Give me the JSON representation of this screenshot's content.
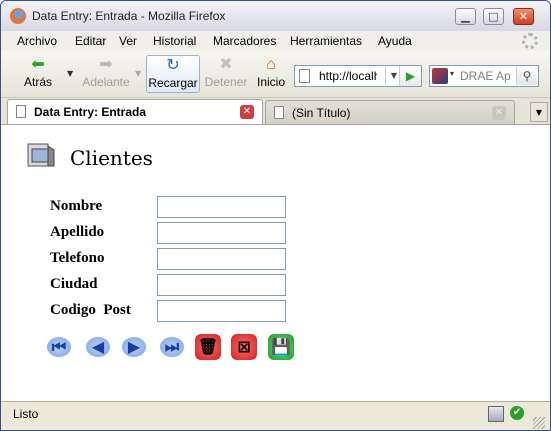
{
  "window": {
    "title": "Data Entry: Entrada - Mozilla Firefox",
    "minimize": "▁",
    "maximize": "□",
    "close": "✕"
  },
  "menu": [
    "Archivo",
    "Editar",
    "Ver",
    "Historial",
    "Marcadores",
    "Herramientas",
    "Ayuda"
  ],
  "toolbar": {
    "back": "Atrás",
    "forward": "Adelante",
    "reload": "Recargar",
    "stop": "Detener",
    "home": "Inicio",
    "url": "http://localhost",
    "search_placeholder": "DRAE Ap"
  },
  "tabs": [
    {
      "label": "Data Entry: Entrada",
      "active": true
    },
    {
      "label": "(Sin Título)",
      "active": false
    }
  ],
  "page": {
    "heading": "Clientes",
    "fields": [
      {
        "label": "Nombre",
        "value": ""
      },
      {
        "label": "Apellido",
        "value": ""
      },
      {
        "label": "Telefono",
        "value": ""
      },
      {
        "label": "Ciudad",
        "value": ""
      },
      {
        "label": "Codigo  Post",
        "value": ""
      }
    ],
    "actions": [
      {
        "name": "first-record",
        "icon": "first-icon"
      },
      {
        "name": "previous-record",
        "icon": "previous-icon"
      },
      {
        "name": "next-record",
        "icon": "next-icon"
      },
      {
        "name": "last-record",
        "icon": "last-icon"
      },
      {
        "name": "delete-record",
        "icon": "trash-icon"
      },
      {
        "name": "cancel-record",
        "icon": "cancel-icon"
      },
      {
        "name": "save-record",
        "icon": "save-icon"
      }
    ]
  },
  "status": {
    "text": "Listo"
  }
}
